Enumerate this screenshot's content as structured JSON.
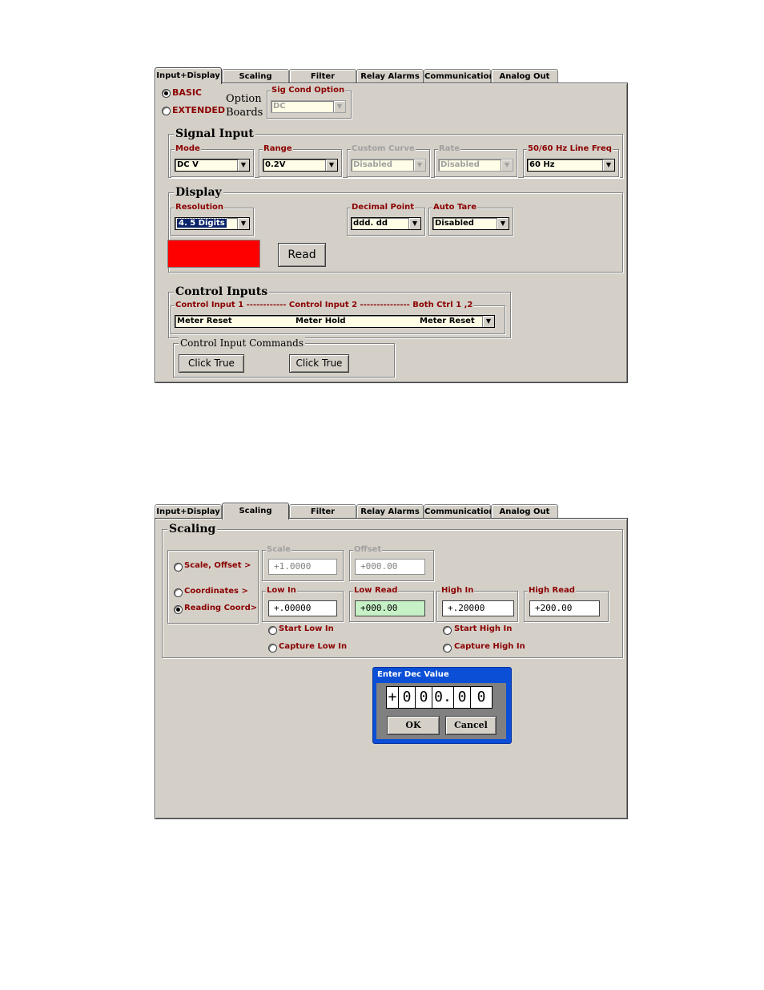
{
  "tabs": [
    "Input+Display",
    "Scaling",
    "Filter",
    "Relay Alarms",
    "Communication",
    "Analog Out"
  ],
  "screen1": {
    "active_tab": "Input+Display",
    "mode_options": {
      "basic": "BASIC",
      "extended": "EXTENDED",
      "selected": "BASIC"
    },
    "option_boards_label": {
      "line1": "Option",
      "line2": "Boards"
    },
    "sig_cond": {
      "label": "Sig Cond Option",
      "value": "DC"
    },
    "signal_input": {
      "title": "Signal Input",
      "mode": {
        "label": "Mode",
        "value": "DC V"
      },
      "range": {
        "label": "Range",
        "value": "0.2V"
      },
      "custom_curve": {
        "label": "Custom Curve",
        "value": "Disabled"
      },
      "rate": {
        "label": "Rate",
        "value": "Disabled"
      },
      "line_freq": {
        "label": "50/60 Hz Line Freq",
        "value": "60 Hz"
      }
    },
    "display": {
      "title": "Display",
      "resolution": {
        "label": "Resolution",
        "value": "4. 5 Digits"
      },
      "decimal_point": {
        "label": "Decimal Point",
        "value": "ddd. dd"
      },
      "auto_tare": {
        "label": "Auto Tare",
        "value": "Disabled"
      },
      "read_button": "Read",
      "indicator_color": "#ff0000"
    },
    "control_inputs": {
      "title": "Control Inputs",
      "header": "Control Input 1 ------------ Control Input 2 --------------- Both Ctrl 1 ,2",
      "values": [
        "Meter Reset",
        "Meter Hold",
        "Meter Reset"
      ]
    },
    "control_commands": {
      "title": "Control Input Commands",
      "button1": "Click True",
      "button2": "Click True"
    }
  },
  "screen2": {
    "active_tab": "Scaling",
    "scaling": {
      "title": "Scaling",
      "options": [
        "Scale, Offset  >",
        "Coordinates  >",
        "Reading Coord>"
      ],
      "selected": "Reading Coord>",
      "scale": {
        "label": "Scale",
        "value": "+1.0000"
      },
      "offset": {
        "label": "Offset",
        "value": "+000.00"
      },
      "low_in": {
        "label": "Low In",
        "value": "+.00000"
      },
      "low_read": {
        "label": "Low Read",
        "value": "+000.00"
      },
      "high_in": {
        "label": "High In",
        "value": "+.20000"
      },
      "high_read": {
        "label": "High Read",
        "value": "+200.00"
      },
      "start_low_in": "Start Low In",
      "capture_low_in": "Capture Low In",
      "start_high_in": "Start High In",
      "capture_high_in": "Capture High In",
      "highlight_color": "#c6f0c6"
    },
    "dialog": {
      "title": "Enter Dec Value",
      "digits": [
        "+",
        "0",
        "0",
        "0.",
        "0",
        "0"
      ],
      "ok": "OK",
      "cancel": "Cancel"
    }
  }
}
